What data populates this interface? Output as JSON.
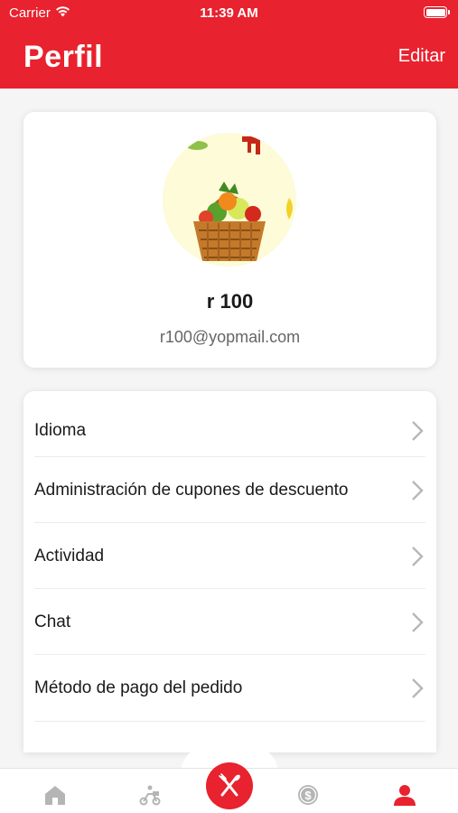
{
  "status_bar": {
    "carrier": "Carrier",
    "time": "11:39 AM"
  },
  "header": {
    "title": "Perfil",
    "edit_label": "Editar"
  },
  "profile": {
    "name": "r 100",
    "email": "r100@yopmail.com"
  },
  "menu": {
    "items": [
      {
        "label": "Idioma"
      },
      {
        "label": "Administración de cupones de descuento"
      },
      {
        "label": "Actividad"
      },
      {
        "label": "Chat"
      },
      {
        "label": "Método de pago del pedido"
      }
    ]
  },
  "tabs": [
    {
      "icon": "home-icon",
      "active": false
    },
    {
      "icon": "delivery-scooter-icon",
      "active": false
    },
    {
      "icon": "fork-knife-icon",
      "active": false
    },
    {
      "icon": "dollar-coin-icon",
      "active": false
    },
    {
      "icon": "user-icon",
      "active": true
    }
  ],
  "colors": {
    "primary": "#e8222e",
    "inactive_icon": "#b5b5b5",
    "background": "#f5f5f5"
  }
}
